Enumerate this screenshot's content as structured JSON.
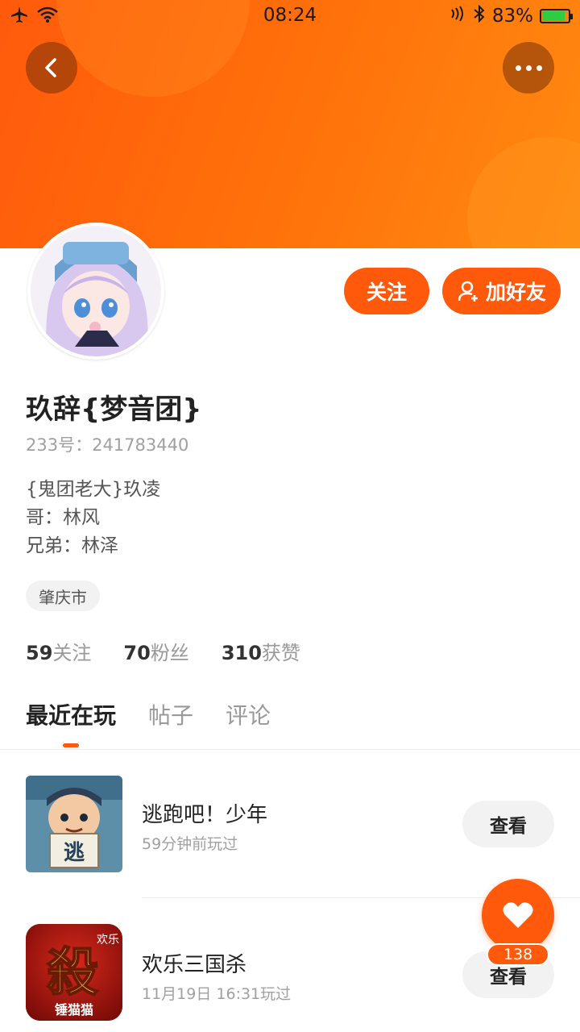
{
  "statusbar": {
    "time": "08:24",
    "battery": "83%"
  },
  "header": {
    "accent": "#ff5a0c"
  },
  "actions": {
    "follow": "关注",
    "add_friend": "加好友"
  },
  "profile": {
    "name": "玖辞{梦音团}",
    "uid": "233号：241783440",
    "bio": [
      "{鬼团老大}玖凌",
      "哥：林风",
      "兄弟：林泽"
    ],
    "city": "肇庆市"
  },
  "stats": {
    "following_count": "59",
    "following_label": "关注",
    "fans_count": "70",
    "fans_label": "粉丝",
    "likes_count": "310",
    "likes_label": "获赞"
  },
  "tabs": [
    "最近在玩",
    "帖子",
    "评论"
  ],
  "games": [
    {
      "name": "逃跑吧！少年",
      "time": "59分钟前玩过",
      "button": "查看",
      "icon_text": "逃"
    },
    {
      "name": "欢乐三国杀",
      "time": "11月19日 16:31玩过",
      "button": "查看",
      "icon_text": "殺",
      "icon_sub": "锤猫猫",
      "icon_corner": "欢乐"
    }
  ],
  "like": {
    "count": "138"
  }
}
